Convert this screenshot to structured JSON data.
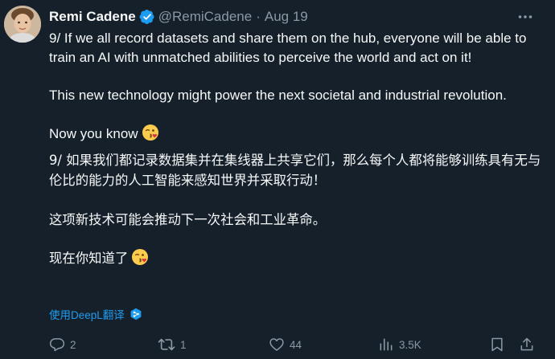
{
  "author": {
    "name": "Remi Cadene",
    "handle": "@RemiCadene",
    "separator": "·",
    "date": "Aug 19"
  },
  "icons": {
    "avatar": "avatar",
    "verified": "verified-badge-icon",
    "more": "more-horizontal-icon",
    "emoji": "face-blowing-kiss-emoji",
    "deepl": "deepl-icon",
    "reply": "reply-icon",
    "retweet": "retweet-icon",
    "like": "like-icon",
    "views": "views-icon",
    "bookmark": "bookmark-icon",
    "share": "share-icon"
  },
  "colors": {
    "background": "#15202b",
    "text": "#f7f9f9",
    "muted": "#8b98a5",
    "accent": "#1d9bf0"
  },
  "tweet": {
    "en_p1": "9/ If we all record datasets and share them on the hub, everyone will be able to train an AI with unmatched abilities to perceive the world and act on it!",
    "en_p2": "This new technology might power the next societal and industrial revolution.",
    "en_p3": "Now you know",
    "zh_p1": "9/ 如果我们都记录数据集并在集线器上共享它们，那么每个人都将能够训练具有无与伦比的能力的人工智能来感知世界并采取行动！",
    "zh_p2": "这项新技术可能会推动下一次社会和工业革命。",
    "zh_p3": "现在你知道了"
  },
  "translate": {
    "label": "使用DeepL翻译"
  },
  "actions": {
    "replies": "2",
    "retweets": "1",
    "likes": "44",
    "views": "3.5K"
  }
}
